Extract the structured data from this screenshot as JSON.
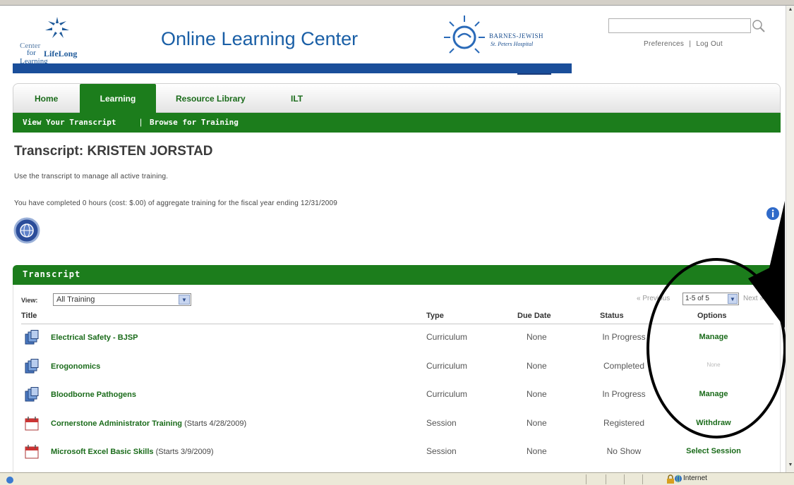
{
  "header": {
    "logo_left_line1": "Center",
    "logo_left_line2": "for",
    "logo_left_line3": "LifeLong",
    "logo_left_line4": "Learning",
    "site_title": "Online Learning Center",
    "hospital_name": "BARNES-JEWISH",
    "hospital_sub": "St. Peters Hospital",
    "search": {
      "value": "",
      "placeholder": ""
    },
    "preferences_label": "Preferences",
    "link_separator": "|",
    "logout_label": "Log Out"
  },
  "nav": {
    "tabs": [
      {
        "label": "Home",
        "active": false
      },
      {
        "label": "Learning",
        "active": true
      },
      {
        "label": "Resource Library",
        "active": false
      },
      {
        "label": "ILT",
        "active": false
      }
    ],
    "subnav": [
      {
        "label": "View Your Transcript"
      },
      {
        "label": "Browse for Training"
      }
    ],
    "subnav_separator": "|"
  },
  "page": {
    "title": "Transcript: KRISTEN JORSTAD",
    "description": "Use the transcript to manage all active training.",
    "summary": "You have completed 0 hours (cost: $.00) of aggregate training for the fiscal year ending 12/31/2009"
  },
  "transcript": {
    "panel_title": "Transcript",
    "view_label": "View:",
    "view_value": "All Training",
    "pager": {
      "previous": "« Previous",
      "range": "1-5 of 5",
      "next": "Next »"
    },
    "columns": [
      "Title",
      "Type",
      "Due Date",
      "Status",
      "Options"
    ],
    "rows": [
      {
        "title": "Electrical Safety - BJSP",
        "subtitle": "",
        "type": "Curriculum",
        "due": "None",
        "status": "In Progress",
        "option": "Manage",
        "option_disabled": false,
        "icon": "curriculum-icon"
      },
      {
        "title": "Erogonomics",
        "subtitle": "",
        "type": "Curriculum",
        "due": "None",
        "status": "Completed",
        "option": "None",
        "option_disabled": true,
        "icon": "curriculum-icon"
      },
      {
        "title": "Bloodborne Pathogens",
        "subtitle": "",
        "type": "Curriculum",
        "due": "None",
        "status": "In Progress",
        "option": "Manage",
        "option_disabled": false,
        "icon": "curriculum-icon"
      },
      {
        "title": "Cornerstone Administrator Training",
        "subtitle": " (Starts 4/28/2009)",
        "type": "Session",
        "due": "None",
        "status": "Registered",
        "option": "Withdraw",
        "option_disabled": false,
        "icon": "calendar-icon"
      },
      {
        "title": "Microsoft Excel Basic Skills",
        "subtitle": " (Starts 3/9/2009)",
        "type": "Session",
        "due": "None",
        "status": "No Show",
        "option": "Select Session",
        "option_disabled": false,
        "icon": "calendar-icon"
      }
    ]
  },
  "statusbar": {
    "zone": "Internet"
  },
  "colors": {
    "brand_green": "#1c7d1c",
    "brand_blue": "#1a4e9a",
    "title_blue": "#1a5fa6",
    "annotation": "#000000"
  }
}
